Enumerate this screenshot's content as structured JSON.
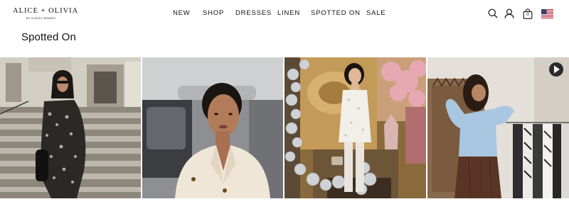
{
  "brand": {
    "name": "ALICE + OLIVIA",
    "tagline": "BY STACEY BENDET"
  },
  "nav": {
    "items": [
      {
        "label": "NEW"
      },
      {
        "label": "SHOP"
      },
      {
        "label": "DRESSES"
      },
      {
        "label": "LINEN"
      },
      {
        "label": "SPOTTED ON"
      },
      {
        "label": "SALE"
      }
    ]
  },
  "header_icons": {
    "search": "search-icon",
    "account": "user-icon",
    "bag": "shopping-bag-icon",
    "bag_count": "0",
    "region": "us-flag-icon"
  },
  "page": {
    "title": "Spotted On"
  },
  "gallery": {
    "tiles": [
      {
        "subject": "woman in printed coat on stone steps",
        "has_video": false
      },
      {
        "subject": "woman in cream blazer in car",
        "has_video": false
      },
      {
        "subject": "woman in white sequin dress with balloons",
        "has_video": false
      },
      {
        "subject": "woman in blue blouse by clothing rack",
        "has_video": true
      }
    ]
  },
  "colors": {
    "text": "#111111",
    "background": "#ffffff"
  }
}
